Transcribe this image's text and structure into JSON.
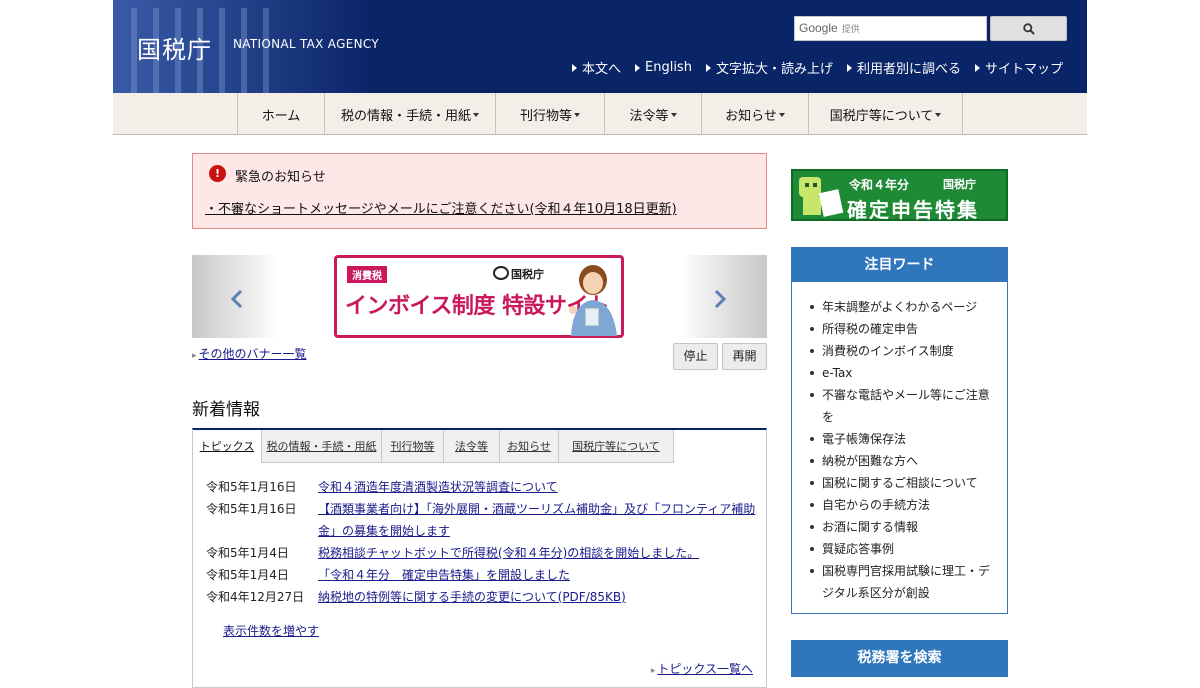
{
  "header": {
    "logo_jp": "国税庁",
    "logo_en": "NATIONAL TAX AGENCY",
    "search": {
      "brand": "Google",
      "sub": "提供",
      "placeholder": ""
    },
    "util_links": [
      "本文へ",
      "English",
      "文字拡大・読み上げ",
      "利用者別に調べる",
      "サイトマップ"
    ]
  },
  "nav": {
    "items": [
      {
        "label": "ホーム",
        "dropdown": false
      },
      {
        "label": "税の情報・手続・用紙",
        "dropdown": true
      },
      {
        "label": "刊行物等",
        "dropdown": true
      },
      {
        "label": "法令等",
        "dropdown": true
      },
      {
        "label": "お知らせ",
        "dropdown": true
      },
      {
        "label": "国税庁等について",
        "dropdown": true
      }
    ]
  },
  "emergency": {
    "title": "緊急のお知らせ",
    "link": "・不審なショートメッセージやメールにご注意ください(令和４年10月18日更新)"
  },
  "banner": {
    "tag": "消費税",
    "logo": "国税庁",
    "title": "インボイス制度 特設サイト",
    "other_link": "その他のバナー一覧",
    "stop_label": "停止",
    "resume_label": "再開"
  },
  "news": {
    "heading": "新着情報",
    "tabs": [
      "トピックス",
      "税の情報・手続・用紙",
      "刊行物等",
      "法令等",
      "お知らせ",
      "国税庁等について"
    ],
    "items": [
      {
        "date": "令和5年1月16日",
        "title": "令和４酒造年度清酒製造状況等調査について"
      },
      {
        "date": "令和5年1月16日",
        "title": "【酒類事業者向け】「海外展開・酒蔵ツーリズム補助金」及び「フロンティア補助金」の募集を開始します"
      },
      {
        "date": "令和5年1月4日",
        "title": "税務相談チャットボットで所得税(令和４年分)の相談を開始しました。"
      },
      {
        "date": "令和5年1月4日",
        "title": "「令和４年分　確定申告特集」を開設しました"
      },
      {
        "date": "令和4年12月27日",
        "title": "納税地の特例等に関する手続の変更について(PDF/85KB)"
      }
    ],
    "show_more": "表示件数を増やす",
    "topics_all": "トピックス一覧へ"
  },
  "sidebar": {
    "tax_return_banner": {
      "line1": "令和４年分",
      "logo": "国税庁",
      "line2": "確定申告特集"
    },
    "keywords_title": "注目ワード",
    "keywords": [
      "年末調整がよくわかるページ",
      "所得税の確定申告",
      "消費税のインボイス制度",
      "e-Tax",
      "不審な電話やメール等にご注意を",
      "電子帳簿保存法",
      "納税が困難な方へ",
      "国税に関するご相談について",
      "自宅からの手続方法",
      "お酒に関する情報",
      "質疑応答事例",
      "国税専門官採用試験に理工・デジタル系区分が創設"
    ],
    "office_search": "税務署を検索"
  },
  "colors": {
    "header_bg": "#0a2468",
    "nav_bg": "#f3efe8",
    "emergency_bg": "#fde7e7",
    "accent_blue": "#2f76bc",
    "invoice_pink": "#c9195c",
    "tax_green": "#1f8a36"
  },
  "icons": {
    "search": "magnifier-icon",
    "alert": "exclamation-circle-icon",
    "prev": "chevron-left-icon",
    "next": "chevron-right-icon"
  }
}
